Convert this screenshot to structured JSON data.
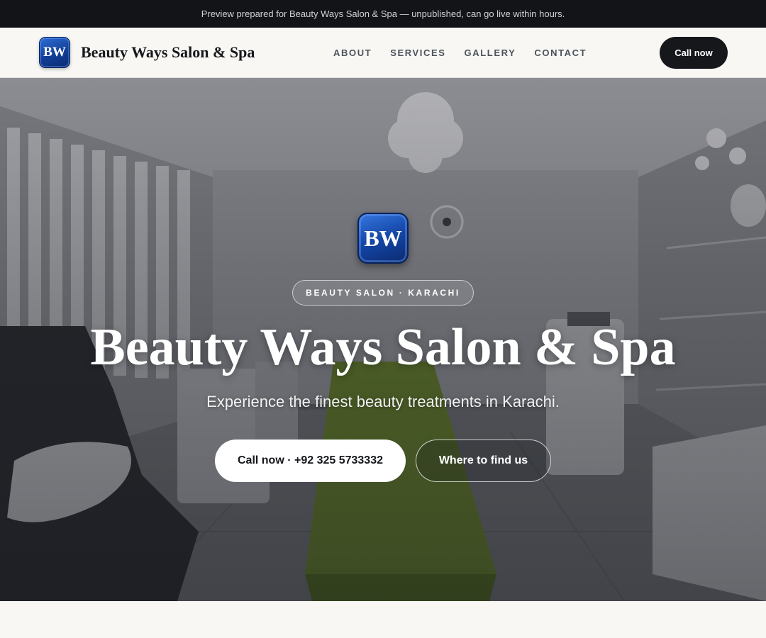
{
  "announcement": "Preview prepared for Beauty Ways Salon & Spa — unpublished, can go live within hours.",
  "brand": {
    "logo_text": "BW",
    "name": "Beauty Ways Salon & Spa"
  },
  "nav": {
    "links": [
      "ABOUT",
      "SERVICES",
      "GALLERY",
      "CONTACT"
    ],
    "cta_label": "Call now"
  },
  "hero": {
    "logo_text": "BW",
    "eyebrow": "BEAUTY SALON · KARACHI",
    "title": "Beauty Ways Salon & Spa",
    "subtitle": "Experience the finest beauty treatments in Karachi.",
    "primary_button": "Call now · +92 325 5733332",
    "secondary_button": "Where to find us"
  },
  "colors": {
    "topbar_bg": "#121418",
    "cta_bg": "#15171b",
    "logo_blue": "#1446a6",
    "page_bg": "#f8f7f4"
  }
}
